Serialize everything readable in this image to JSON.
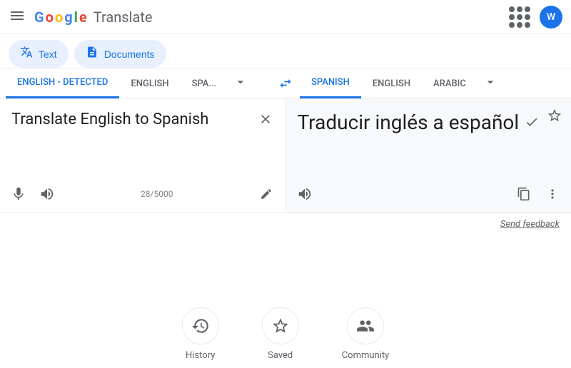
{
  "header": {
    "menu_label": "menu",
    "logo": {
      "full_text": "Google Translate",
      "g1": "G",
      "o1": "o",
      "o2": "o",
      "g2": "g",
      "l": "l",
      "e": "e",
      "translate": "Translate"
    },
    "dots_label": "apps",
    "avatar_letter": "W"
  },
  "mode_tabs": {
    "text_label": "Text",
    "documents_label": "Documents"
  },
  "language_selector": {
    "source_languages": [
      {
        "label": "ENGLISH - DETECTED",
        "active": true
      },
      {
        "label": "ENGLISH",
        "active": false
      },
      {
        "label": "SPA...",
        "active": false
      }
    ],
    "target_languages": [
      {
        "label": "SPANISH",
        "active": true
      },
      {
        "label": "ENGLISH",
        "active": false
      },
      {
        "label": "ARABIC",
        "active": false
      }
    ]
  },
  "source_panel": {
    "input_text": "Translate English to Spanish",
    "char_count": "28/5000",
    "mic_label": "mic",
    "speaker_label": "speaker",
    "edit_label": "edit"
  },
  "target_panel": {
    "translated_text": "Traducir inglés a español",
    "speaker_label": "speaker",
    "copy_label": "copy",
    "more_label": "more",
    "verified_label": "verified",
    "star_label": "star"
  },
  "feedback": {
    "label": "Send feedback"
  },
  "bottom_nav": {
    "items": [
      {
        "label": "History",
        "icon": "history"
      },
      {
        "label": "Saved",
        "icon": "star"
      },
      {
        "label": "Community",
        "icon": "people"
      }
    ]
  }
}
